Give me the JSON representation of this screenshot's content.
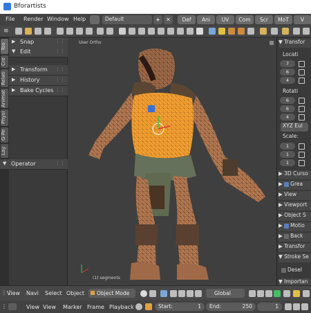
{
  "app": {
    "title": "Bforartists"
  },
  "menubar": {
    "items": [
      "File",
      "Render",
      "Window",
      "Help"
    ],
    "screen": "Default",
    "tabs": [
      "Def",
      "Ani",
      "UV",
      "Com",
      "Scr",
      "MoT",
      "V"
    ]
  },
  "tool_shelf": {
    "vertical_tabs": [
      "Too",
      "Cre",
      "Relati",
      "Animat",
      "Physi",
      "G-Pe",
      "Lay"
    ],
    "panels": [
      {
        "label": "Snap",
        "expanded": false
      },
      {
        "label": "Edit",
        "expanded": true
      },
      {
        "label": "Transform",
        "expanded": false
      },
      {
        "label": "History",
        "expanded": false
      },
      {
        "label": "Bake Cycles",
        "expanded": false
      }
    ],
    "operator": "Operator"
  },
  "viewport": {
    "view_label": "User Ortho",
    "mesh_info": "(1) segments"
  },
  "n_panel": {
    "transform_header": "Transfor",
    "location_label": "Locati",
    "location": [
      "7",
      "6",
      "4"
    ],
    "rotation_label": "Rotati",
    "rotation": [
      "6",
      "6",
      "4"
    ],
    "rotation_mode": "XYZ Eul",
    "scale_label": "Scale:",
    "scale": [
      "1",
      "1",
      "1"
    ],
    "sections": [
      {
        "label": "3D Curso",
        "checkbox": null,
        "expanded": false
      },
      {
        "label": "Grea",
        "checkbox": true,
        "expanded": false
      },
      {
        "label": "View",
        "checkbox": null,
        "expanded": false
      },
      {
        "label": "Viewport",
        "checkbox": null,
        "expanded": false
      },
      {
        "label": "Object S",
        "checkbox": null,
        "expanded": false
      },
      {
        "label": "Motio",
        "checkbox": true,
        "expanded": false
      },
      {
        "label": "Back",
        "checkbox": false,
        "expanded": false
      },
      {
        "label": "Transfor",
        "checkbox": null,
        "expanded": false
      },
      {
        "label": "Stroke Se",
        "checkbox": null,
        "expanded": true
      }
    ],
    "desel": "Desel",
    "important": "Importan"
  },
  "header3d": {
    "menus": [
      "View",
      "Navi",
      "Select",
      "Object"
    ],
    "mode": "Object Mode",
    "orientation": "Global"
  },
  "timeline": {
    "menus": [
      "View",
      "Marker",
      "Frame",
      "Playback"
    ],
    "start_label": "Start:",
    "start_value": "1",
    "end_label": "End:",
    "end_value": "250",
    "current_frame": "1"
  },
  "colors": {
    "selection": "#f5a030",
    "skin": "#b57a52",
    "accent": "#5680c2"
  }
}
